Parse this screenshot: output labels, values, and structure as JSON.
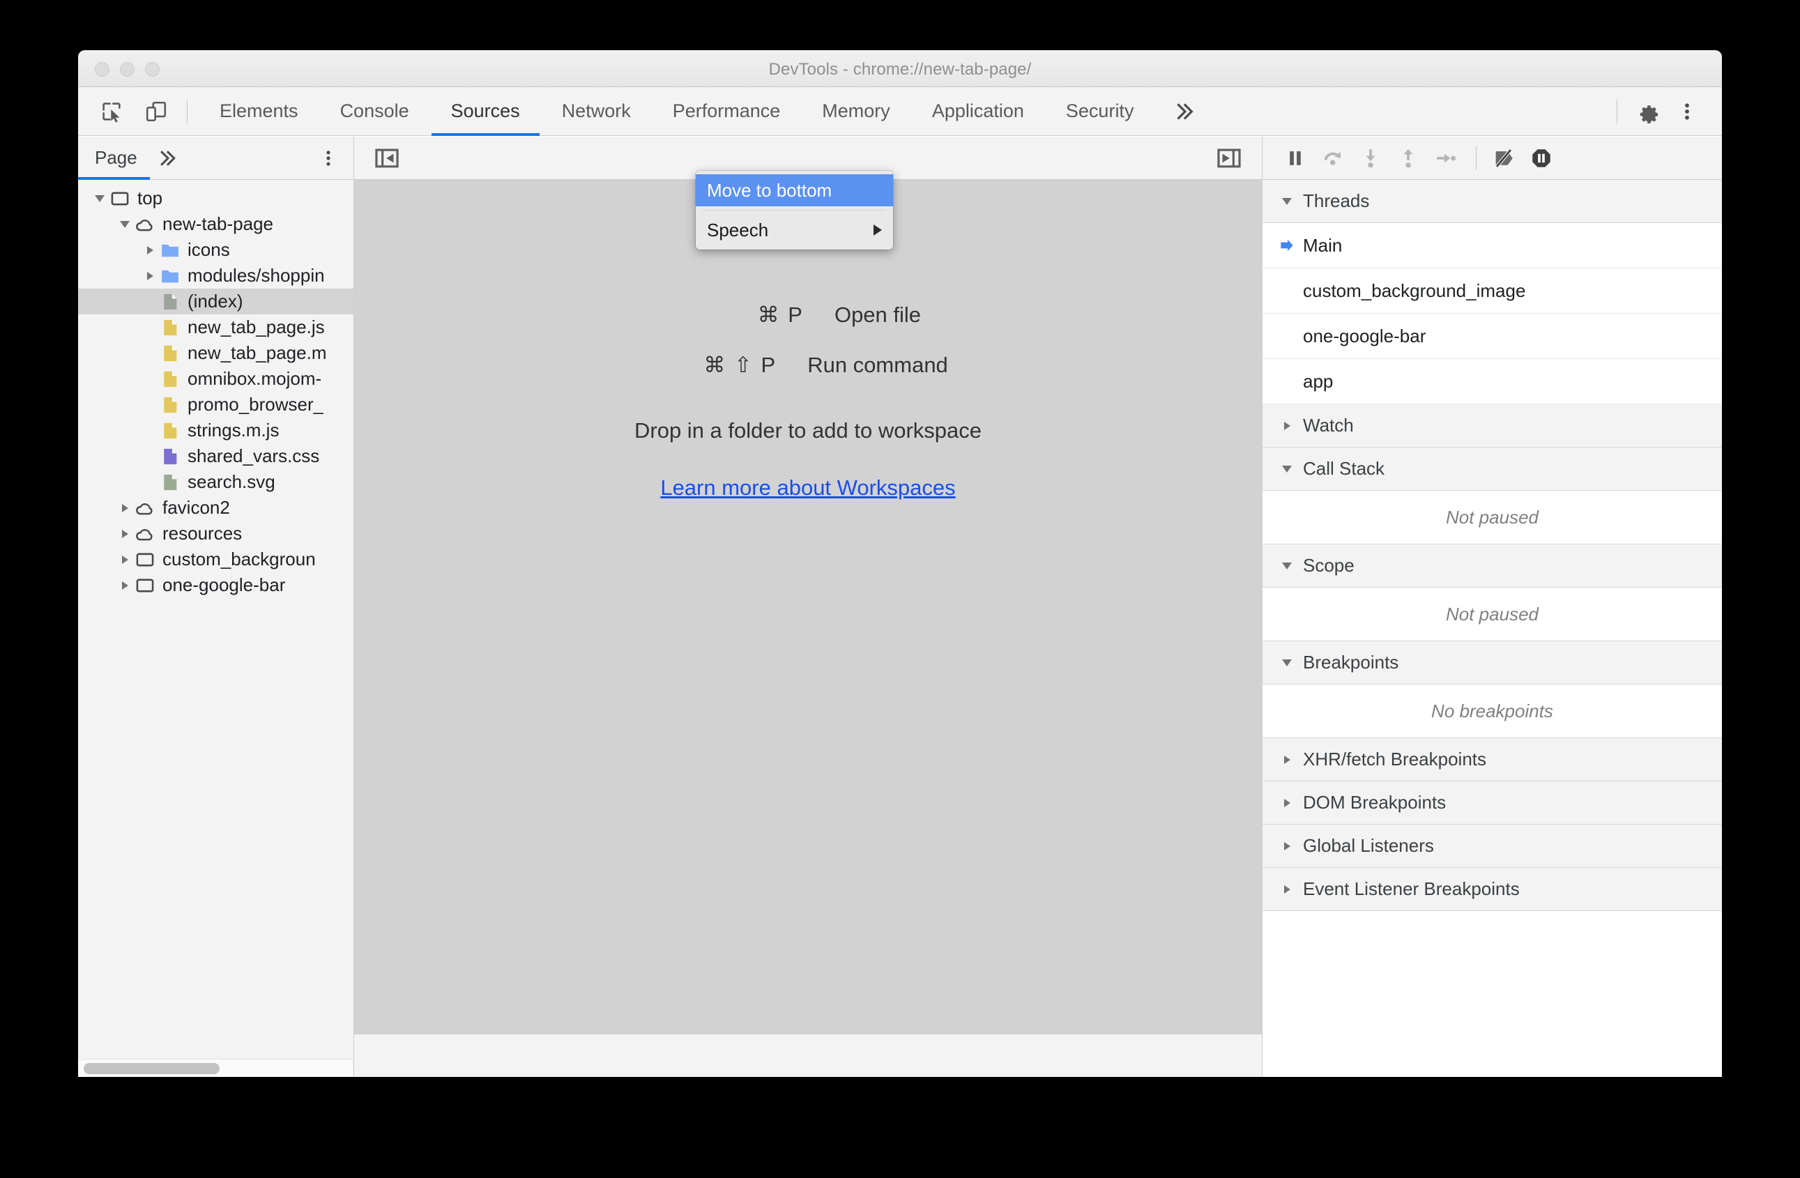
{
  "window": {
    "title": "DevTools - chrome://new-tab-page/",
    "traffic_lights": [
      "close",
      "minimize",
      "maximize"
    ]
  },
  "tabbar": {
    "inspect_icon": "inspect-element-icon",
    "device_icon": "device-toolbar-icon",
    "tabs": [
      {
        "label": "Elements",
        "active": false
      },
      {
        "label": "Console",
        "active": false
      },
      {
        "label": "Sources",
        "active": true
      },
      {
        "label": "Network",
        "active": false
      },
      {
        "label": "Performance",
        "active": false
      },
      {
        "label": "Memory",
        "active": false
      },
      {
        "label": "Application",
        "active": false
      },
      {
        "label": "Security",
        "active": false
      }
    ],
    "more_tabs_icon": "chevron-double-right-icon",
    "settings_icon": "gear-icon",
    "menu_icon": "kebab-menu-icon"
  },
  "context_menu": {
    "items": [
      {
        "label": "Move to bottom",
        "highlight": true,
        "submenu": false
      },
      {
        "label": "Speech",
        "highlight": false,
        "submenu": true
      }
    ]
  },
  "navigator": {
    "tab_label": "Page",
    "more_tabs_icon": "chevron-double-right-icon",
    "kebab_icon": "kebab-menu-icon",
    "tree": [
      {
        "label": "top",
        "depth": 0,
        "icon": "frame",
        "twisty": "open",
        "selected": false
      },
      {
        "label": "new-tab-page",
        "depth": 1,
        "icon": "cloud",
        "twisty": "open",
        "selected": false
      },
      {
        "label": "icons",
        "depth": 2,
        "icon": "folder",
        "twisty": "closed",
        "selected": false
      },
      {
        "label": "modules/shoppin",
        "depth": 2,
        "icon": "folder",
        "twisty": "closed",
        "selected": false
      },
      {
        "label": "(index)",
        "depth": 2,
        "icon": "doc-gray",
        "twisty": "none",
        "selected": true
      },
      {
        "label": "new_tab_page.js",
        "depth": 2,
        "icon": "doc-yellow",
        "twisty": "none",
        "selected": false
      },
      {
        "label": "new_tab_page.m",
        "depth": 2,
        "icon": "doc-yellow",
        "twisty": "none",
        "selected": false
      },
      {
        "label": "omnibox.mojom-",
        "depth": 2,
        "icon": "doc-yellow",
        "twisty": "none",
        "selected": false
      },
      {
        "label": "promo_browser_",
        "depth": 2,
        "icon": "doc-yellow",
        "twisty": "none",
        "selected": false
      },
      {
        "label": "strings.m.js",
        "depth": 2,
        "icon": "doc-yellow",
        "twisty": "none",
        "selected": false
      },
      {
        "label": "shared_vars.css",
        "depth": 2,
        "icon": "doc-purple",
        "twisty": "none",
        "selected": false
      },
      {
        "label": "search.svg",
        "depth": 2,
        "icon": "doc-green",
        "twisty": "none",
        "selected": false
      },
      {
        "label": "favicon2",
        "depth": 1,
        "icon": "cloud",
        "twisty": "closed",
        "selected": false
      },
      {
        "label": "resources",
        "depth": 1,
        "icon": "cloud",
        "twisty": "closed",
        "selected": false
      },
      {
        "label": "custom_backgroun",
        "depth": 1,
        "icon": "frame",
        "twisty": "closed",
        "selected": false
      },
      {
        "label": "one-google-bar",
        "depth": 1,
        "icon": "frame",
        "twisty": "closed",
        "selected": false
      }
    ],
    "scrollbar": "horizontal-scrollbar"
  },
  "editor": {
    "hide_navigator_icon": "hide-navigator-panel-icon",
    "show_debugger_icon": "show-debugger-panel-icon",
    "shortcuts": [
      {
        "keys": "⌘ P",
        "label": "Open file"
      },
      {
        "keys": "⌘ ⇧ P",
        "label": "Run command"
      }
    ],
    "drop_hint": "Drop in a folder to add to workspace",
    "learn_link": "Learn more about Workspaces"
  },
  "debugger": {
    "toolbar": [
      {
        "icon": "pause-script-icon"
      },
      {
        "icon": "step-over-icon"
      },
      {
        "icon": "step-into-icon"
      },
      {
        "icon": "step-out-icon"
      },
      {
        "icon": "step-icon"
      },
      {
        "icon": "deactivate-breakpoints-icon"
      },
      {
        "icon": "pause-on-exceptions-icon"
      }
    ],
    "sections": {
      "threads": {
        "title": "Threads",
        "expanded": true,
        "items": [
          {
            "label": "Main",
            "current": true
          },
          {
            "label": "custom_background_image",
            "current": false
          },
          {
            "label": "one-google-bar",
            "current": false
          },
          {
            "label": "app",
            "current": false
          }
        ]
      },
      "watch": {
        "title": "Watch",
        "expanded": false
      },
      "call_stack": {
        "title": "Call Stack",
        "expanded": true,
        "empty_text": "Not paused"
      },
      "scope": {
        "title": "Scope",
        "expanded": true,
        "empty_text": "Not paused"
      },
      "breakpoints": {
        "title": "Breakpoints",
        "expanded": true,
        "empty_text": "No breakpoints"
      },
      "xhr": {
        "title": "XHR/fetch Breakpoints",
        "expanded": false
      },
      "dom": {
        "title": "DOM Breakpoints",
        "expanded": false
      },
      "global": {
        "title": "Global Listeners",
        "expanded": false
      },
      "event": {
        "title": "Event Listener Breakpoints",
        "expanded": false
      }
    }
  },
  "colors": {
    "accent": "#1a73e8",
    "menu_highlight": "#5b91f0",
    "link": "#1a4df0",
    "folder": "#7baaf7",
    "doc_yellow": "#e2c85c",
    "doc_purple": "#7a6fd0",
    "doc_green": "#9aab93",
    "doc_gray": "#9da49c"
  }
}
